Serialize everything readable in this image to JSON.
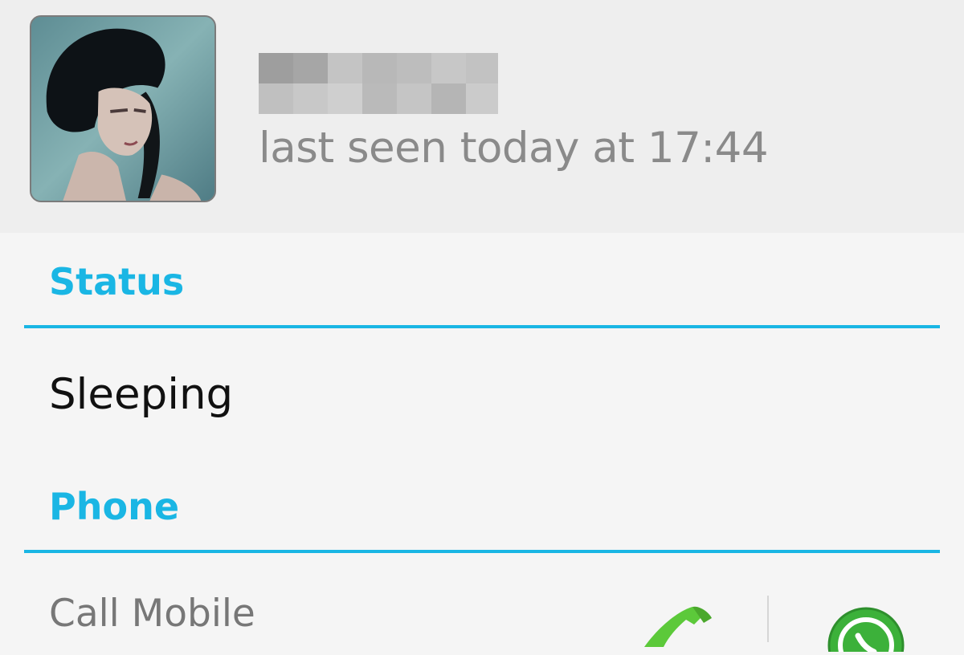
{
  "contact": {
    "last_seen": "last seen today at 17:44"
  },
  "sections": {
    "status_title": "Status",
    "status_value": "Sleeping",
    "phone_title": "Phone",
    "call_label": "Call Mobile"
  },
  "icons": {
    "avatar": "contact-photo",
    "call": "phone-handset-icon",
    "chat": "whatsapp-icon"
  },
  "colors": {
    "accent": "#1ab6e4",
    "call_green": "#5cc93a",
    "whatsapp_green": "#3cb13a"
  }
}
